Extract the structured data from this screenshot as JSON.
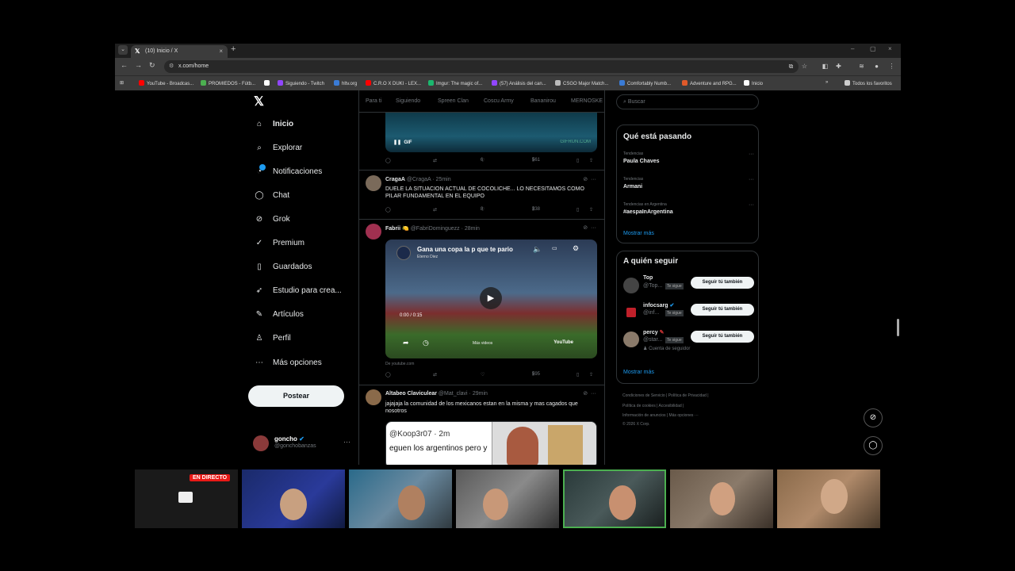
{
  "browser": {
    "tab_title": "(10) Inicio / X",
    "tab_close": "×",
    "tab_favicon": "𝕏",
    "new_tab": "+",
    "url": "x.com/home",
    "window_controls": [
      "–",
      "▢",
      "×"
    ],
    "bookmarks": [
      {
        "label": "YouTube - Broadcas...",
        "color": "#ff0000"
      },
      {
        "label": "PROMIEDOS - Fútb...",
        "color": "#4caf50"
      },
      {
        "label": "",
        "color": "#ffffff"
      },
      {
        "label": "Siguiendo - Twitch",
        "color": "#9146ff"
      },
      {
        "label": "hltv.org",
        "color": "#3a7bd5"
      },
      {
        "label": "C.R.O X DUKI - LEX...",
        "color": "#ff0000"
      },
      {
        "label": "Imgur: The magic of...",
        "color": "#1bb76e"
      },
      {
        "label": "(57) Análisis del can...",
        "color": "#9146ff"
      },
      {
        "label": "CSGO Major Match...",
        "color": "#bbbbbb"
      },
      {
        "label": "Comfortably Numb...",
        "color": "#3a7bd5"
      },
      {
        "label": "Adventure and RPG...",
        "color": "#e05a2a"
      },
      {
        "label": "Inicio",
        "color": "#ffffff"
      }
    ],
    "bookmarks_more": "»",
    "all_bookmarks": "Todos los favoritos"
  },
  "sidebar": {
    "logo": "𝕏",
    "items": [
      {
        "label": "Inicio",
        "icon": "home-icon",
        "glyph": "⌂"
      },
      {
        "label": "Explorar",
        "icon": "search-icon",
        "glyph": "⌕"
      },
      {
        "label": "Notificaciones",
        "icon": "bell-icon",
        "glyph": "🔔"
      },
      {
        "label": "Chat",
        "icon": "chat-icon",
        "glyph": "◯"
      },
      {
        "label": "Grok",
        "icon": "grok-icon",
        "glyph": "⊘"
      },
      {
        "label": "Premium",
        "icon": "verified-icon",
        "glyph": "✓"
      },
      {
        "label": "Guardados",
        "icon": "bookmark-icon",
        "glyph": "▯"
      },
      {
        "label": "Estudio para crea...",
        "icon": "rocket-icon",
        "glyph": "➶"
      },
      {
        "label": "Artículos",
        "icon": "articles-icon",
        "glyph": "✎"
      },
      {
        "label": "Perfil",
        "icon": "profile-icon",
        "glyph": "♙"
      },
      {
        "label": "Más opciones",
        "icon": "more-options-icon",
        "glyph": "⋯"
      }
    ],
    "post_button": "Postear",
    "account": {
      "name": "goncho",
      "handle": "@gonchobanzas"
    }
  },
  "feed": {
    "tabs": [
      "Para ti",
      "Siguiendo",
      "Spreen Clan",
      "Coscu Army",
      "Bananirou",
      "MERNOSKE"
    ],
    "gif_label": "GIF",
    "gif_watermark": "GIFRUN.COM",
    "post0_actions": {
      "likes": "6",
      "views": "561"
    },
    "posts": [
      {
        "name": "CragaA",
        "handle": "@CragaA",
        "time": "· 25min",
        "text": "DUELE LA SITUACION ACTUAL DE COCOLICHE... LO NECESITAMOS COMO PILAR FUNDAMENTAL EN EL EQUIPO",
        "likes": "8",
        "views": "338"
      },
      {
        "name": "Fabrii 🍋",
        "handle": "@FabriDominguezz",
        "time": "· 28min",
        "video_title": "Gana una copa la p que te pario",
        "video_channel": "Eterno Diez",
        "video_time": "0:00 / 0:15",
        "video_more": "Más videos",
        "video_brand": "YouTube",
        "source": "De youtube.com",
        "views": "595"
      },
      {
        "name": "Altabeo Claviculear",
        "handle": "@Mat_clavi",
        "time": "· 29min",
        "text": "jajajaja la comunidad de los mexicanos estan en la misma y mas cagados que nosotros",
        "quote_handle": "@Koop3r07 · 2m",
        "quote_text": "eguen los argentinos pero y"
      }
    ]
  },
  "right": {
    "search_placeholder": "Buscar",
    "trends_title": "Qué está pasando",
    "trends": [
      {
        "context": "Tendencias",
        "title": "Paula Chaves"
      },
      {
        "context": "Tendencias",
        "title": "Armani"
      },
      {
        "context": "Tendencias en Argentina",
        "title": "#aespaInArgentina"
      }
    ],
    "show_more": "Mostrar más",
    "follow_title": "A quién seguir",
    "follow": [
      {
        "name": "Top",
        "handle": "@Top...",
        "tag": "Te sigue",
        "button": "Seguir tú también"
      },
      {
        "name": "infocsarg",
        "handle": "@inf...",
        "tag": "Te sigue",
        "button": "Seguir tú también"
      },
      {
        "name": "percy",
        "handle": "@star...",
        "tag": "Te sigue",
        "button": "Seguir tú también",
        "extra": "Cuenta de seguidor"
      }
    ],
    "footer": [
      "Condiciones de Servicio  |  Política de Privacidad  |",
      "Política de cookies  |  Accesibilidad  |",
      "Información de anuncios  |  Más opciones ···",
      "© 2026 X Corp."
    ]
  },
  "stream": {
    "live_label": "EN DIRECTO"
  }
}
